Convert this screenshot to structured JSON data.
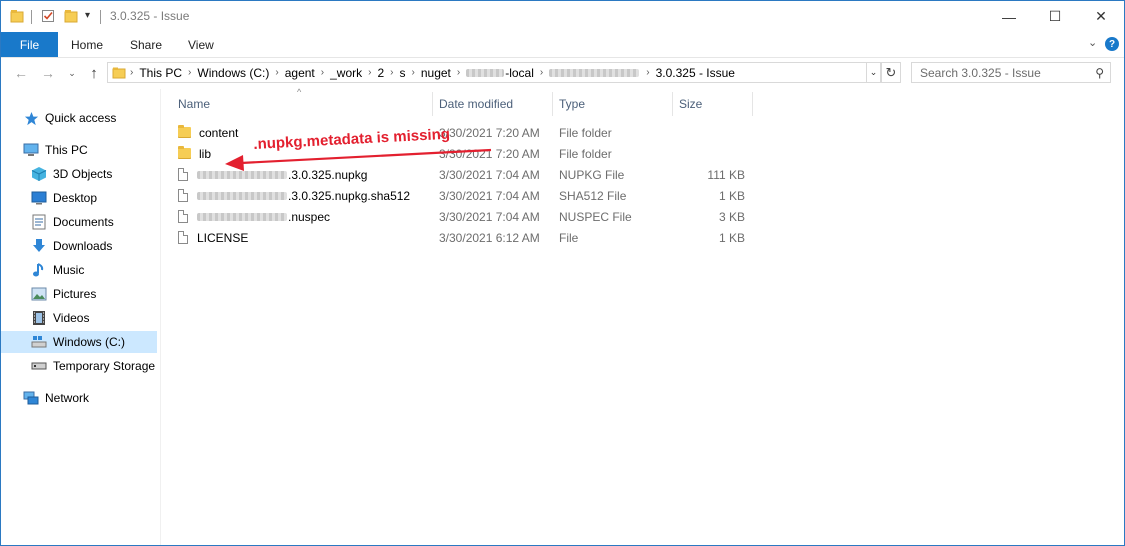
{
  "window": {
    "title": "3.0.325 - Issue",
    "controls": {
      "minimize": "—",
      "maximize": "☐",
      "close": "✕"
    }
  },
  "ribbon": {
    "tabs": [
      "File",
      "Home",
      "Share",
      "View"
    ],
    "expand_label": "⌄",
    "help_label": "?"
  },
  "address": {
    "crumbs": [
      "This PC",
      "Windows (C:)",
      "agent",
      "_work",
      "2",
      "s",
      "nuget",
      "-local",
      "",
      "3.0.325 - Issue"
    ],
    "search_placeholder": "Search 3.0.325 - Issue"
  },
  "nav_pane": {
    "items": [
      {
        "label": "Quick access",
        "icon": "star-icon"
      },
      {
        "label": "This PC",
        "icon": "monitor-icon"
      },
      {
        "label": "3D Objects",
        "icon": "cube-icon"
      },
      {
        "label": "Desktop",
        "icon": "desktop-icon"
      },
      {
        "label": "Documents",
        "icon": "document-icon"
      },
      {
        "label": "Downloads",
        "icon": "download-icon"
      },
      {
        "label": "Music",
        "icon": "music-icon"
      },
      {
        "label": "Pictures",
        "icon": "picture-icon"
      },
      {
        "label": "Videos",
        "icon": "video-icon"
      },
      {
        "label": "Windows (C:)",
        "icon": "drive-icon",
        "selected": true
      },
      {
        "label": "Temporary Storage",
        "icon": "drive-icon"
      },
      {
        "label": "Network",
        "icon": "network-icon"
      }
    ]
  },
  "file_list": {
    "columns": [
      "Name",
      "Date modified",
      "Type",
      "Size"
    ],
    "rows": [
      {
        "name": "content",
        "date": "3/30/2021 7:20 AM",
        "type": "File folder",
        "size": "",
        "kind": "folder"
      },
      {
        "name": "lib",
        "date": "3/30/2021 7:20 AM",
        "type": "File folder",
        "size": "",
        "kind": "folder"
      },
      {
        "name": ".3.0.325.nupkg",
        "date": "3/30/2021 7:04 AM",
        "type": "NUPKG File",
        "size": "111 KB",
        "kind": "file",
        "blurred": true
      },
      {
        "name": ".3.0.325.nupkg.sha512",
        "date": "3/30/2021 7:04 AM",
        "type": "SHA512 File",
        "size": "1 KB",
        "kind": "file",
        "blurred": true
      },
      {
        "name": ".nuspec",
        "date": "3/30/2021 7:04 AM",
        "type": "NUSPEC File",
        "size": "3 KB",
        "kind": "file",
        "blurred": true
      },
      {
        "name": "LICENSE",
        "date": "3/30/2021 6:12 AM",
        "type": "File",
        "size": "1 KB",
        "kind": "file"
      }
    ]
  },
  "annotation": {
    "text": ".nupkg.metadata is missing",
    "color": "#e3202f"
  },
  "colors": {
    "accent": "#1979ca",
    "selected_bg": "#cce8ff",
    "folder": "#f6cd55"
  }
}
